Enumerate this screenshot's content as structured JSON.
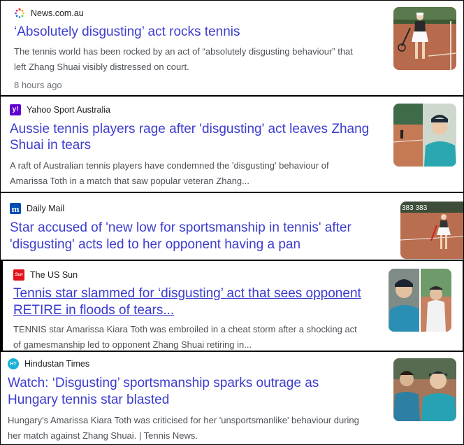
{
  "articles": [
    {
      "source": "News.com.au",
      "headline": "‘Absolutely disgusting’ act rocks tennis",
      "snippet_line1": "The tennis world has been rocked by an act of “absolutely disgusting behaviour” that",
      "snippet_line2": "left Zhang Shuai visibly distressed on court.",
      "time": "8 hours ago",
      "favicon": "news-com-au-spinner-icon",
      "thumbnail": "tennis-player-white-skirt-clay-court"
    },
    {
      "source": "Yahoo Sport Australia",
      "headline_line1": "Aussie tennis players rage after 'disgusting' act leaves Zhang",
      "headline_line2": "Shuai in tears",
      "snippet_line1": "A raft of Australian tennis players have condemned the 'disgusting' behaviour of",
      "snippet_line2": "Amarissa Toth in a match that saw popular veteran Zhang...",
      "favicon_text": "y!",
      "favicon_color": "#6001d2",
      "thumbnail": "tennis-court-and-player-in-cap"
    },
    {
      "source": "Daily Mail",
      "headline_line1": "Star accused of 'new low for sportsmanship in tennis' after",
      "headline_line2": "'disgusting' acts led to her opponent having a pan",
      "favicon_text": "m",
      "favicon_color": "#004db3",
      "thumbnail": "tennis-player-clay-court-scoreboard",
      "thumb_overlay_text": "383 383"
    },
    {
      "source": "The US Sun",
      "headline_line1": "Tennis star slammed for ‘disgusting’ act that sees opponent",
      "headline_line2": "RETIRE in floods of tears...",
      "snippet_line1": "TENNIS star Amarissa Kiara Toth was embroiled in a cheat storm after a shocking act",
      "snippet_line2": "of gamesmanship led to opponent Zhang Shuai retiring in...",
      "favicon_text": "Sun",
      "favicon_color": "#e4121a",
      "thumbnail": "two-tennis-players-split"
    },
    {
      "source": "Hindustan Times",
      "headline_line1": "Watch: ‘Disgusting’ sportsmanship sparks outrage as",
      "headline_line2": "Hungary tennis star blasted",
      "snippet_line1": "Hungary's Amarissa Kiara Toth was criticised for her 'unsportsmanlike' behaviour during",
      "snippet_line2": "her match against Zhang Shuai. | Tennis News.",
      "favicon_text": "HT",
      "favicon_color": "#1ab1d6",
      "thumbnail": "two-tennis-players-side-by-side"
    }
  ]
}
